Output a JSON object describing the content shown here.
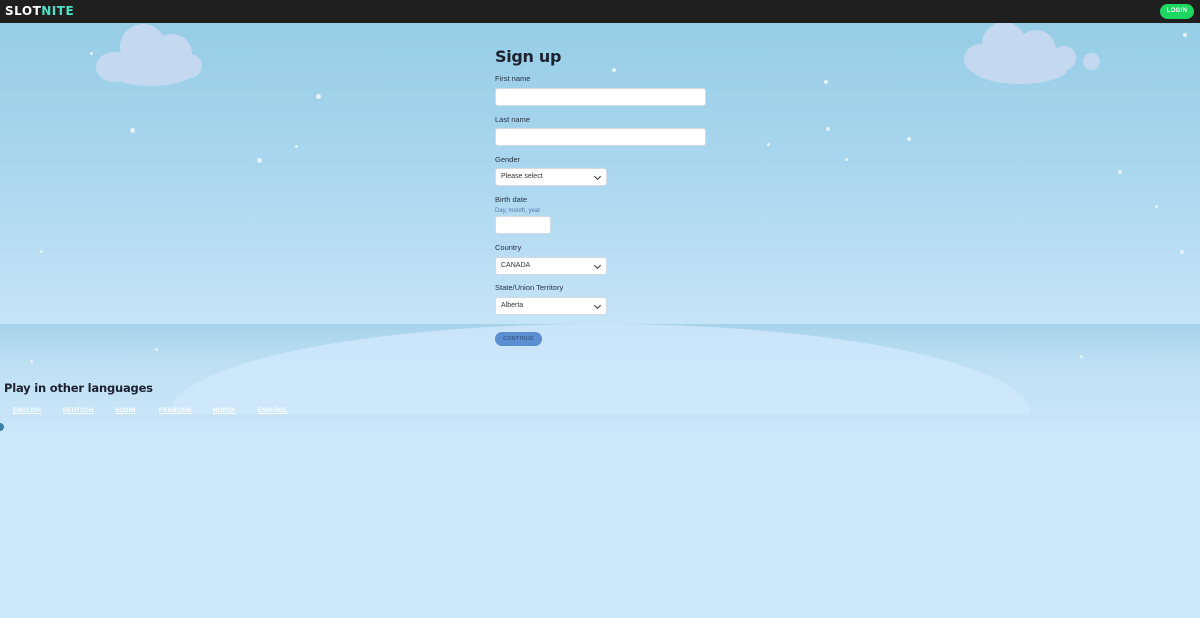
{
  "header": {
    "logo_a": "SLOT",
    "logo_b": "NITE",
    "login_label": "LOGIN"
  },
  "signup": {
    "title": "Sign up",
    "first_name_label": "First name",
    "last_name_label": "Last name",
    "gender_label": "Gender",
    "gender_value": "Please select",
    "birth_date_label": "Birth date",
    "birth_date_hint": "Day, month, year",
    "country_label": "Country",
    "country_value": "CANADA",
    "state_label": "State/Union Territory",
    "state_value": "Alberta",
    "continue_label": "CONTINUE"
  },
  "languages": {
    "title": "Play in other languages",
    "links": [
      "ENGLISH",
      "DEUTSCH",
      "SUOMI",
      "FRANÇAIS",
      "NORSK",
      "ESPAÑOL"
    ]
  },
  "colors": {
    "header_bg": "#1f1f1f",
    "login_green": "#1ed760",
    "sky_top": "#97cde6",
    "page_bg": "#cde7fb",
    "continue_blue": "#5b8fd1"
  },
  "icons": {
    "select_arrow": "chevron-down-icon"
  }
}
